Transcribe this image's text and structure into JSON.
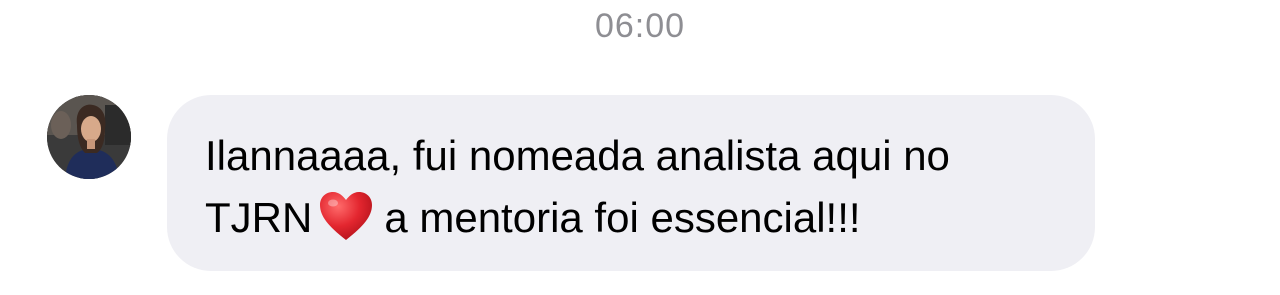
{
  "chat": {
    "timestamp": "06:00",
    "message": {
      "line1": "Ilannaaaa, fui nomeada analista aqui no",
      "line2_before": "TJRN",
      "emoji": "red-heart-icon",
      "line2_after": "a mentoria foi essencial!!!"
    },
    "colors": {
      "bubble": "#efeff4",
      "timestamp": "#8e8e93",
      "heart": "#e3262f"
    }
  }
}
